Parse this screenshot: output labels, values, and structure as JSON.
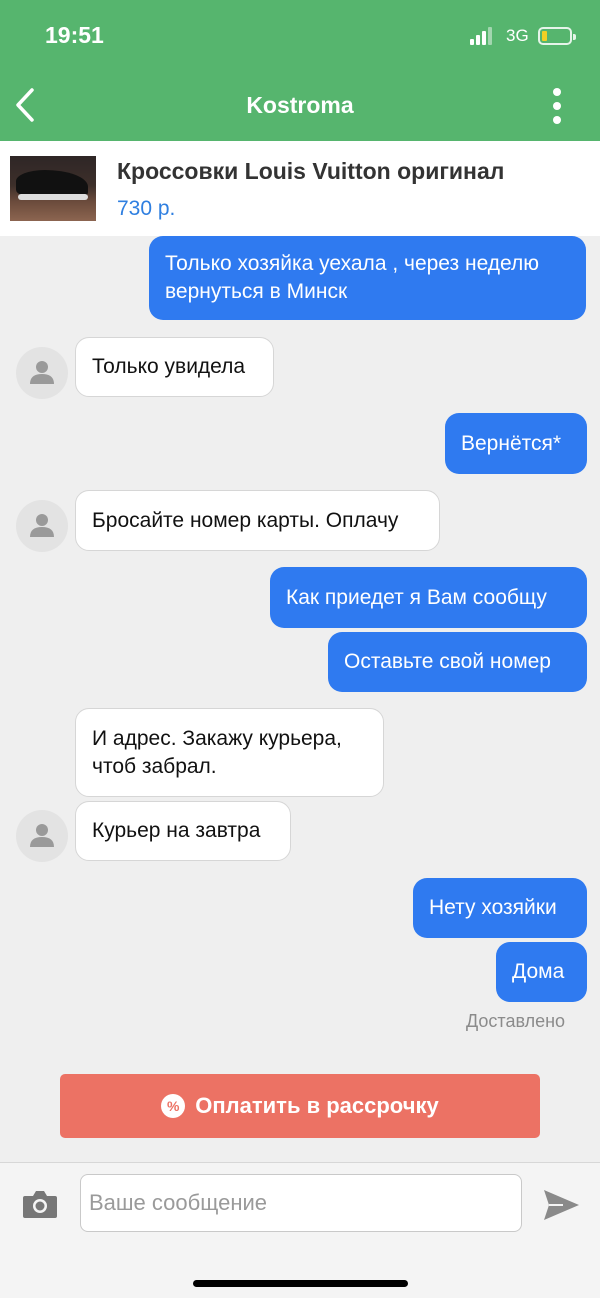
{
  "status_bar": {
    "time": "19:51",
    "network": "3G",
    "battery_color": "#f2d024"
  },
  "header": {
    "title": "Kostroma",
    "back_icon": "chevron-left-icon",
    "menu_icon": "more-vertical-icon",
    "background": "#56b56e"
  },
  "product": {
    "title": "Кроссовки Louis Vuitton оригинал",
    "price": "730 р."
  },
  "messages": [
    {
      "direction": "out",
      "text": [
        "Только хозяйка уехала , через неделю",
        "вернуться в Минск"
      ]
    },
    {
      "direction": "in",
      "text": [
        "Только увидела"
      ]
    },
    {
      "direction": "out",
      "text": [
        "Вернётся*"
      ]
    },
    {
      "direction": "in",
      "text": [
        "Бросайте номер карты. Оплачу"
      ]
    },
    {
      "direction": "out",
      "text": [
        "Как приедет я Вам сообщу"
      ]
    },
    {
      "direction": "out",
      "text": [
        "Оставьте свой номер"
      ]
    },
    {
      "direction": "in",
      "text": [
        "И адрес. Закажу курьера,",
        "чтоб забрал."
      ]
    },
    {
      "direction": "in",
      "text": [
        "Курьер на завтра"
      ]
    },
    {
      "direction": "out",
      "text": [
        "Нету хозяйки"
      ]
    },
    {
      "direction": "out",
      "text": [
        "Дома"
      ]
    }
  ],
  "delivery_status": "Доставлено",
  "installment_button": {
    "label": "Оплатить в рассрочку",
    "icon_glyph": "%",
    "color": "#ec7264"
  },
  "composer": {
    "placeholder": "Ваше сообщение",
    "camera_icon": "camera-icon",
    "send_icon": "send-icon"
  },
  "colors": {
    "outgoing_bubble": "#2f7af0",
    "incoming_bubble": "#ffffff",
    "price": "#2f7fe0"
  }
}
